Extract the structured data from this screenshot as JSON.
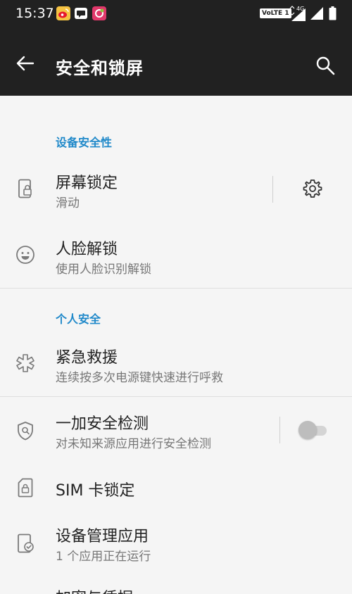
{
  "status_bar": {
    "time": "15:37",
    "volte_label": "VoLTE 1",
    "network_label": "4G",
    "notifications": [
      "weibo-icon",
      "message-icon",
      "app-notification-icon"
    ]
  },
  "app_bar": {
    "title": "安全和锁屏",
    "back_icon": "arrow-left-icon",
    "search_icon": "search-icon"
  },
  "sections": [
    {
      "header": "设备安全性",
      "items": [
        {
          "title": "屏幕锁定",
          "subtitle": "滑动",
          "icon": "phone-lock-icon",
          "action": "gear-icon"
        },
        {
          "title": "人脸解锁",
          "subtitle": "使用人脸识别解锁",
          "icon": "face-icon"
        }
      ]
    },
    {
      "header": "个人安全",
      "items": [
        {
          "title": "紧急救援",
          "subtitle": "连续按多次电源键快速进行呼救",
          "icon": "emergency-icon"
        }
      ]
    },
    {
      "header": "",
      "items": [
        {
          "title": "一加安全检测",
          "subtitle": "对未知来源应用进行安全检测",
          "icon": "shield-icon",
          "toggle_on": false
        },
        {
          "title": "SIM 卡锁定",
          "subtitle": "",
          "icon": "sim-lock-icon"
        },
        {
          "title": "设备管理应用",
          "subtitle": "1 个应用正在运行",
          "icon": "device-admin-icon"
        },
        {
          "title": "加密与凭据",
          "subtitle": "",
          "icon": ""
        }
      ]
    }
  ],
  "colors": {
    "app_bar": "#212121",
    "background": "#f5f5f5",
    "accent": "#1e88c9",
    "title_text": "#222222",
    "subtitle_text": "#777777"
  }
}
